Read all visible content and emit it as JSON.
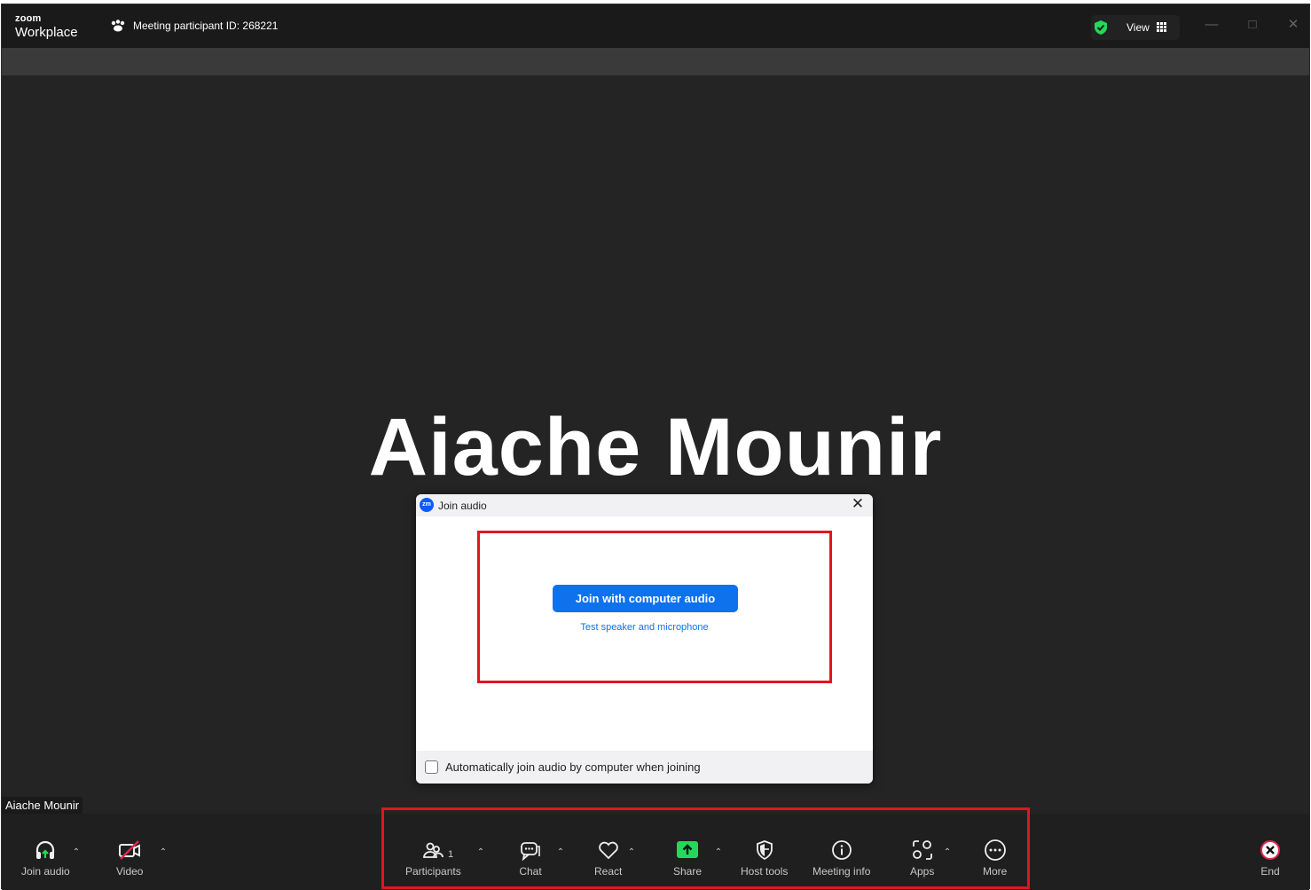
{
  "titlebar": {
    "logo_top": "zoom",
    "logo_bottom": "Workplace",
    "meeting_id": "Meeting participant ID: 268221",
    "view_label": "View",
    "controls": [
      "minimize",
      "maximize",
      "close"
    ]
  },
  "video": {
    "participant_display": "Aiache Mounir",
    "name_tag": "Aiache Mounir"
  },
  "dialog": {
    "title": "Join audio",
    "logo_text": "zm",
    "join_button": "Join with computer audio",
    "test_link": "Test speaker and microphone",
    "auto_join_label": "Automatically join audio by computer when joining",
    "auto_join_checked": false
  },
  "toolbar": {
    "join_audio": "Join audio",
    "video": "Video",
    "participants": "Participants",
    "participants_count": "1",
    "chat": "Chat",
    "react": "React",
    "share": "Share",
    "host_tools": "Host tools",
    "meeting_info": "Meeting info",
    "apps": "Apps",
    "more": "More",
    "end": "End"
  },
  "colors": {
    "accent": "#0e72ed",
    "share_green": "#23d959",
    "highlight_red": "#e0161e",
    "end_red": "#e02850"
  }
}
